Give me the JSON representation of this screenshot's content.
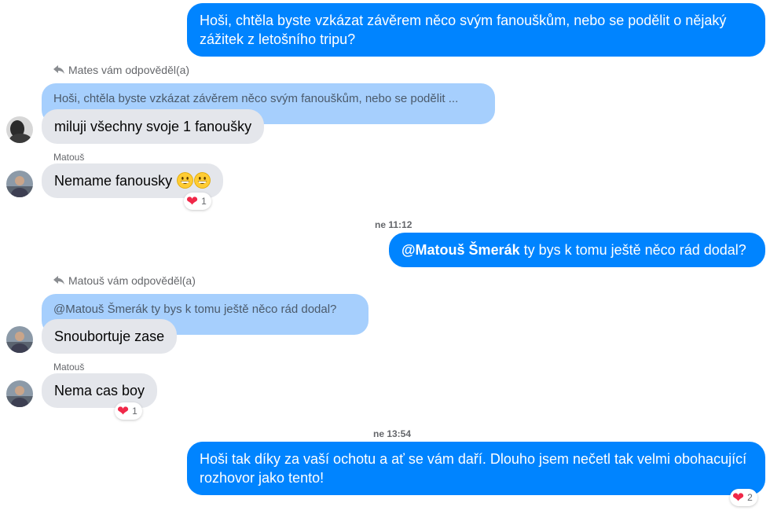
{
  "messages": {
    "m1": "Hoši, chtěla byste vzkázat závěrem něco svým fanouškům, nebo se podělit o nějaký zážitek z letošního tripu?",
    "reply1_header": "Mates vám odpověděl(a)",
    "reply1_quote": "Hoši, chtěla byste vzkázat závěrem něco svým fanouškům, nebo se podělit ...",
    "reply1_text": "miluji všechny svoje 1 fanoušky",
    "sender_matous_1": "Matouš",
    "m3_text": "Nemame fanousky",
    "m3_reaction_count": "1",
    "time_1": "ne 11:12",
    "m4_mention": "@Matouš Šmerák",
    "m4_text": " ty bys k tomu ještě něco rád dodal?",
    "reply2_header": "Matouš vám odpověděl(a)",
    "reply2_quote": "@Matouš Šmerák ty bys k tomu ještě něco rád dodal?",
    "reply2_text": "Snoubortuje zase",
    "sender_matous_2": "Matouš",
    "m6_text": "Nema cas boy",
    "m6_reaction_count": "1",
    "time_2": "ne 13:54",
    "m7_text": "Hoši tak díky za vaší ochotu a ať se vám daří. Dlouho jsem nečetl tak velmi obohacující rozhovor jako tento!",
    "m7_reaction_count": "2"
  },
  "icons": {
    "reply": "reply-arrow-icon",
    "heart": "heart-icon",
    "smile": "grinning-face-icon"
  },
  "colors": {
    "outgoing": "#0084ff",
    "incoming": "#e4e6eb",
    "quote": "#a6cffd",
    "heart": "#f02849"
  }
}
